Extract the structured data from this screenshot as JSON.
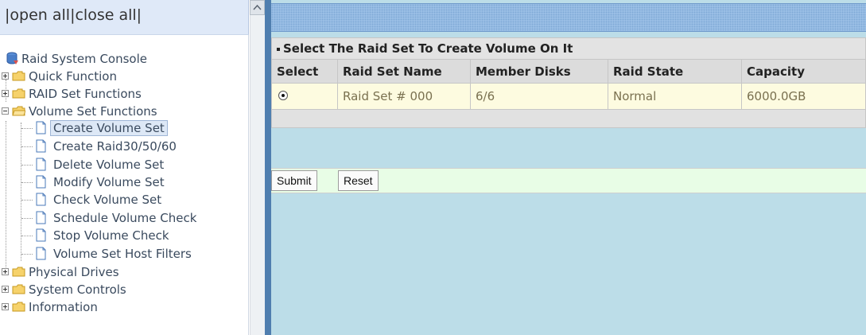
{
  "topbar": {
    "sep_left": "|",
    "open_all": "open all",
    "sep_mid": "|",
    "close_all": "close all",
    "sep_right": "|"
  },
  "nav": {
    "root": "Raid System Console",
    "quick_function": "Quick Function",
    "raid_set_functions": "RAID Set Functions",
    "volume_set_functions": "Volume Set Functions",
    "volume_items": [
      "Create Volume Set",
      "Create Raid30/50/60",
      "Delete Volume Set",
      "Modify Volume Set",
      "Check Volume Set",
      "Schedule Volume Check",
      "Stop Volume Check",
      "Volume Set Host Filters"
    ],
    "physical_drives": "Physical Drives",
    "system_controls": "System Controls",
    "information": "Information"
  },
  "main": {
    "section_title": "Select The Raid Set To Create Volume On It",
    "columns": [
      "Select",
      "Raid Set Name",
      "Member Disks",
      "Raid State",
      "Capacity"
    ],
    "rows": [
      {
        "name": "Raid Set # 000",
        "member_disks": "6/6",
        "state": "Normal",
        "capacity": "6000.0GB",
        "selected": true
      }
    ],
    "submit_label": "Submit",
    "reset_label": "Reset"
  },
  "colors": {
    "frame_blue": "#4f7eaf",
    "content_bg": "#bcdde8",
    "data_row_bg": "#fdfbe0",
    "button_bar_bg": "#e8fde6"
  }
}
